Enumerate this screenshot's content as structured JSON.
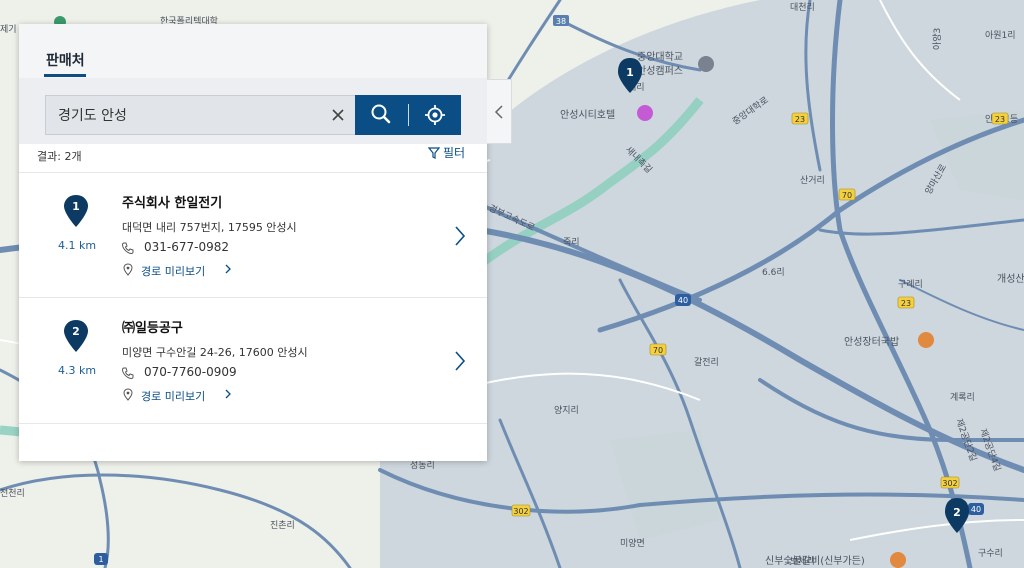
{
  "panel": {
    "tab_label": "판매처",
    "search": {
      "value": "경기도 안성"
    },
    "result_count": "결과: 2개",
    "filter_label": "필터"
  },
  "results": [
    {
      "pin": "1",
      "distance": "4.1 km",
      "name": "주식회사 한일전기",
      "address": "대덕면 내리 757번지, 17595 안성시",
      "phone": "031-677-0982",
      "route_label": "경로 미리보기"
    },
    {
      "pin": "2",
      "distance": "4.3 km",
      "name": "㈜일등공구",
      "address": "미양면 구수안길 24-26, 17600 안성시",
      "phone": "070-7760-0909",
      "route_label": "경로 미리보기"
    }
  ],
  "map": {
    "labels": [
      "한국폴리텍대학",
      "중앙대학교",
      "안성캠퍼스",
      "내리",
      "안성시티호텔",
      "중앙대학로",
      "새내촉길",
      "산거리",
      "양마산로",
      "죽리",
      "6.6리",
      "구례리",
      "개성산",
      "안성장터국밥",
      "갈전리",
      "양지리",
      "성동리",
      "계록리",
      "제2공단2길",
      "제2공단4길",
      "진촌리",
      "미양면",
      "보체리",
      "신부숯불갈비(신부가든)",
      "구수리",
      "안성고등",
      "대천리",
      "아원1리",
      "아양3",
      "전천리",
      "경부고속도로",
      "제기"
    ],
    "route_shields": [
      "38",
      "23",
      "70",
      "40",
      "23",
      "70",
      "302",
      "302",
      "40",
      "1",
      "23"
    ],
    "markers": [
      "1",
      "2"
    ],
    "colors": {
      "base": "#eef0ea",
      "overlay": "#c7d2db",
      "road": "#6f8db2",
      "water": "#8fcfbf",
      "pin": "#0d3a63",
      "accent": "#0a4e85"
    }
  }
}
